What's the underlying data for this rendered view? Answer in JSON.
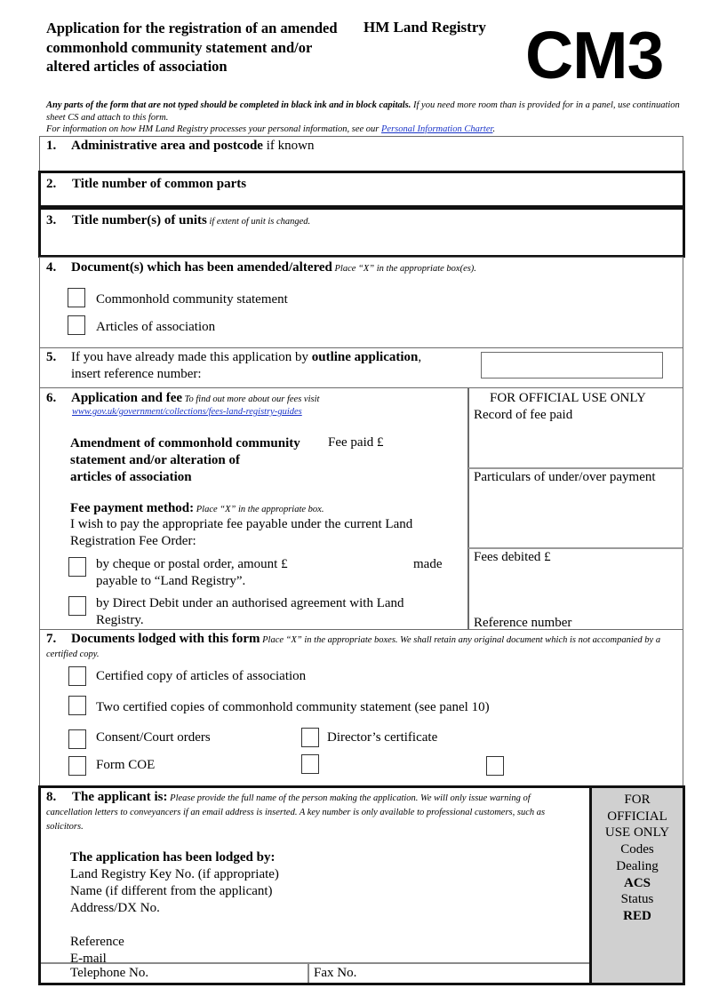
{
  "header": {
    "title": "Application for the registration of an amended commonhold community statement and/or altered articles of association",
    "agency": "HM Land Registry",
    "form_code": "CM3"
  },
  "intro": {
    "instruction_bold": "Any parts of the form that are not typed should be completed in black ink and in block capitals.",
    "instruction_rest": " If you need more room than is provided for in a panel, use continuation sheet CS and attach to this form.",
    "privacy_text": "For information on how HM Land Registry processes your personal information, see our ",
    "privacy_link": "Personal Information Charter",
    "privacy_end": "."
  },
  "panels": {
    "p1": {
      "num": "1.",
      "title": "Administrative area and postcode",
      "suffix": " if known"
    },
    "p2": {
      "num": "2.",
      "title": "Title number of common parts"
    },
    "p3": {
      "num": "3.",
      "title": "Title number(s) of units",
      "note": " if extent of unit is changed."
    },
    "p4": {
      "num": "4.",
      "title": "Document(s) which has been amended/altered",
      "note": " Place “X” in the appropriate box(es).",
      "options": [
        "Commonhold community statement",
        "Articles of association"
      ]
    },
    "p5": {
      "num": "5.",
      "text_before": "If you have already made this application by ",
      "text_bold": "outline application",
      "text_after": ",",
      "line2": "insert reference number:",
      "reference_value": ""
    },
    "p6": {
      "num": "6.",
      "title": "Application and fee",
      "note": " To find out more about our fees visit",
      "fees_link": "www.gov.uk/government/collections/fees-land-registry-guides",
      "application_type_lines": [
        "Amendment of commonhold community",
        "statement and/or alteration of",
        "articles of association"
      ],
      "fee_paid_label": "Fee paid £",
      "fee_paid_value": "",
      "payment_method_title": "Fee payment method:",
      "payment_method_note": " Place “X” in the appropriate box.",
      "payment_intro_1": "I wish to pay the appropriate fee payable under the current Land",
      "payment_intro_2": "Registration Fee Order:",
      "cheque_line1": "by cheque or postal order, amount £",
      "cheque_made": "made",
      "cheque_line2": "payable to “Land Registry”.",
      "dd_line1": "by Direct Debit under an authorised agreement with Land",
      "dd_line2": "Registry.",
      "official": {
        "heading": "FOR OFFICIAL USE ONLY",
        "record_fee": "Record of fee paid",
        "particulars": "Particulars of under/over payment",
        "fees_debited": "Fees debited £",
        "reference_number": "Reference number"
      }
    },
    "p7": {
      "num": "7.",
      "title": "Documents lodged with this form",
      "note": " Place “X” in the appropriate boxes. We shall retain any original document which is not accompanied by a certified copy.",
      "options": {
        "certified_articles": "Certified copy of articles of association",
        "two_certified_ccs": "Two certified copies of commonhold community statement (see panel 10)",
        "consent_court": "Consent/Court orders",
        "directors_cert": "Director’s certificate",
        "form_coe": "Form COE"
      }
    },
    "p8": {
      "num": "8.",
      "title": "The applicant is:",
      "note": " Please provide the full name of the person making the application. We will only issue warning of cancellation letters to conveyancers if an email address is inserted. A key number is only available to professional customers, such as solicitors.",
      "lodged_by_title": "The application has been lodged by:",
      "fields": {
        "key_no": "Land Registry Key No. (if appropriate)",
        "name": "Name (if different from the applicant)",
        "address": "Address/DX No.",
        "reference": "Reference",
        "email": "E-mail",
        "telephone": "Telephone No.",
        "fax": "Fax No."
      },
      "official": {
        "line1": "FOR",
        "line2": "OFFICIAL",
        "line3": "USE ONLY",
        "codes": "Codes",
        "dealing": "Dealing",
        "dealing_code": "ACS",
        "status": "Status",
        "status_code": "RED"
      }
    }
  }
}
